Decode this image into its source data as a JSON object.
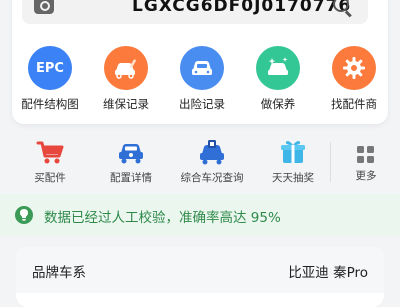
{
  "search": {
    "vin": "LGXCG6DF0J0170776",
    "scan_icon": "camera-scan-icon",
    "search_icon": "search-icon"
  },
  "features": [
    {
      "label": "配件结构图",
      "icon": "epc-icon",
      "color": "#3b82f6",
      "badge": "EPC"
    },
    {
      "label": "维保记录",
      "icon": "car-repair-icon",
      "color": "#fb7a3c"
    },
    {
      "label": "出险记录",
      "icon": "car-accident-icon",
      "color": "#4a8df0"
    },
    {
      "label": "做保养",
      "icon": "car-wash-icon",
      "color": "#34c796"
    },
    {
      "label": "找配件商",
      "icon": "gear-icon",
      "color": "#fb7a3c"
    }
  ],
  "secondary": [
    {
      "label": "买配件",
      "icon": "shopping-cart-icon",
      "color": "#e8473d"
    },
    {
      "label": "配置详情",
      "icon": "car-config-icon",
      "color": "#2f6fd6"
    },
    {
      "label": "综合车况查询",
      "icon": "car-status-icon",
      "color": "#2f6fd6"
    },
    {
      "label": "天天抽奖",
      "icon": "gift-icon",
      "color": "#3fb6e8"
    }
  ],
  "more": {
    "label": "更多",
    "icon": "grid-icon"
  },
  "banner": {
    "text": "数据已经过人工校验，准确率高达 95%",
    "icon": "lightbulb-icon",
    "color": "#2f8a4a"
  },
  "vehicle": {
    "brand_label": "品牌车系",
    "brand_value": "比亚迪 秦Pro"
  }
}
